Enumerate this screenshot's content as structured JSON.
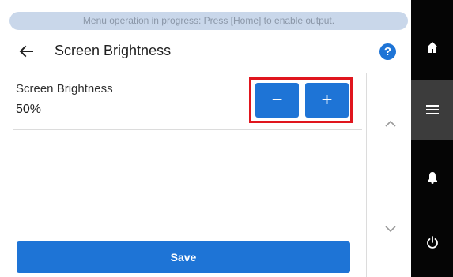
{
  "banner": {
    "text": "Menu operation in progress: Press [Home] to enable output."
  },
  "header": {
    "back_icon": "arrow-left-icon",
    "title": "Screen Brightness",
    "help_label": "?"
  },
  "setting": {
    "label": "Screen Brightness",
    "value": "50%",
    "decrease_label": "−",
    "increase_label": "+"
  },
  "scroll": {
    "up_icon": "chevron-up-icon",
    "down_icon": "chevron-down-icon"
  },
  "footer": {
    "save_label": "Save"
  },
  "side_nav": {
    "items": [
      {
        "icon": "home-icon"
      },
      {
        "icon": "menu-icon",
        "active": true
      },
      {
        "icon": "bell-icon"
      },
      {
        "icon": "power-icon"
      }
    ]
  },
  "colors": {
    "accent": "#1e74d6",
    "highlight": "#e0161e",
    "banner_bg": "#c9d7ea",
    "nav_bg": "#050505",
    "nav_active": "#3c3c3c"
  }
}
